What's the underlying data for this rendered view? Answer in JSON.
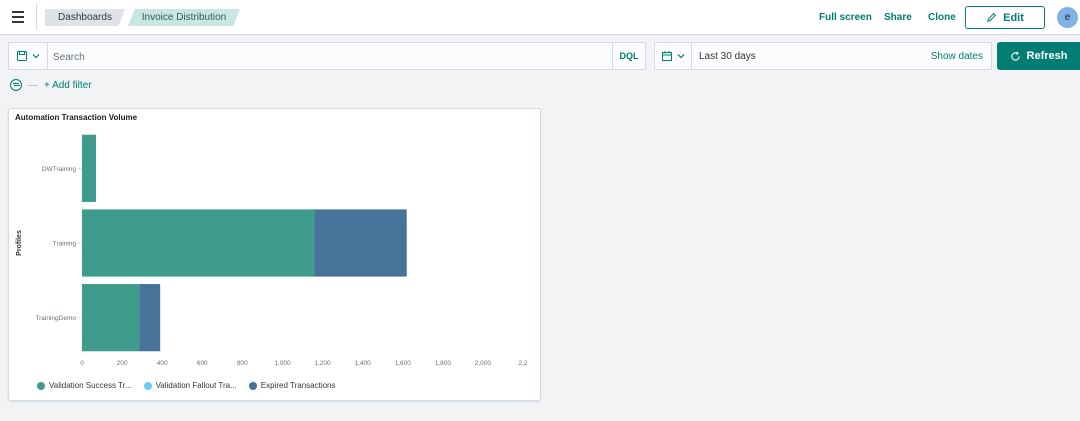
{
  "topbar": {
    "breadcrumbs": [
      "Dashboards",
      "Invoice Distribution"
    ],
    "links": {
      "fullscreen": "Full screen",
      "share": "Share",
      "clone": "Clone"
    },
    "edit_label": "Edit",
    "avatar_initial": "e"
  },
  "query": {
    "search_placeholder": "Search",
    "language": "DQL",
    "date_range": "Last 30 days",
    "show_dates": "Show dates",
    "refresh_label": "Refresh"
  },
  "filters": {
    "add_filter_label": "+ Add filter"
  },
  "colors": {
    "accent": "#017d73",
    "validation_success": "#3f9b8c",
    "validation_fallout": "#6dccf1",
    "expired": "#47729a"
  },
  "panel": {
    "title": "Automation Transaction Volume"
  },
  "chart_data": {
    "type": "bar",
    "orientation": "horizontal",
    "stacked": true,
    "categories": [
      "DWTraining",
      "Training",
      "TrainingDemo"
    ],
    "ylabel": "Profiles",
    "xlabel": "",
    "xlim": [
      0,
      2200
    ],
    "x_ticks": [
      0,
      200,
      400,
      600,
      800,
      1000,
      1200,
      1400,
      1600,
      1800,
      2000,
      2200
    ],
    "x_tick_labels": [
      "0",
      "200",
      "400",
      "600",
      "800",
      "1,000",
      "1,200",
      "1,400",
      "1,600",
      "1,800",
      "2,000",
      "2,2"
    ],
    "legend_position": "bottom",
    "series": [
      {
        "name": "Validation Success Tr...",
        "color": "#3f9b8c",
        "values": [
          70,
          1160,
          285
        ]
      },
      {
        "name": "Validation Fallout Tra...",
        "color": "#6dccf1",
        "values": [
          0,
          0,
          0
        ]
      },
      {
        "name": "Expired Transactions",
        "color": "#47729a",
        "values": [
          0,
          460,
          105
        ]
      }
    ]
  }
}
